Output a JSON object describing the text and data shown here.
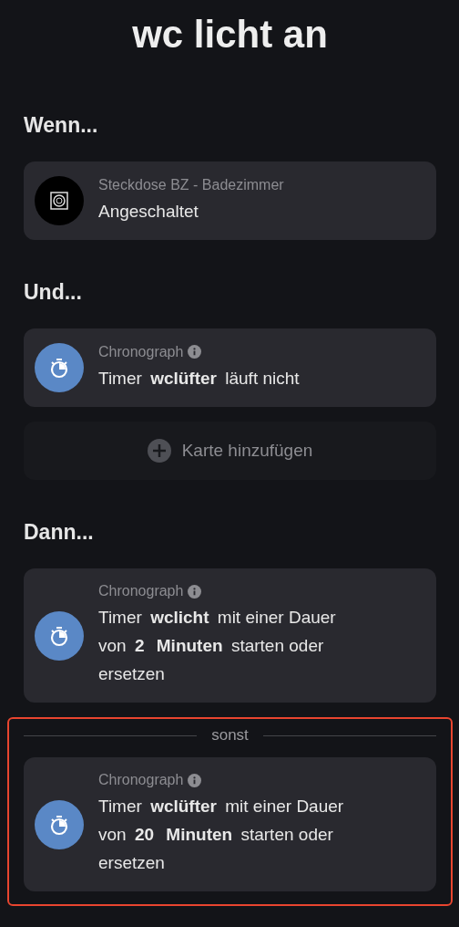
{
  "title": "wc licht an",
  "sections": [
    {
      "heading": "Wenn...",
      "cards": [
        {
          "kind": "device",
          "title": "Steckdose BZ - Badezimmer",
          "info": false,
          "text": "Angeschaltet"
        }
      ]
    },
    {
      "heading": "Und...",
      "cards": [
        {
          "kind": "timer",
          "title": "Chronograph",
          "info": true,
          "text": "Timer **wclüfter** läuft nicht"
        }
      ],
      "add_button": "Karte hinzufügen"
    },
    {
      "heading": "Dann...",
      "cards": [
        {
          "kind": "timer",
          "title": "Chronograph",
          "info": true,
          "text": "Timer **wclicht** mit einer Dauer von **2** **Minuten** starten oder ersetzen"
        }
      ],
      "else": {
        "label": "sonst",
        "highlighted": true,
        "cards": [
          {
            "kind": "timer",
            "title": "Chronograph",
            "info": true,
            "text": "Timer **wclüfter** mit einer Dauer von **20** **Minuten** starten oder ersetzen"
          }
        ]
      }
    }
  ]
}
